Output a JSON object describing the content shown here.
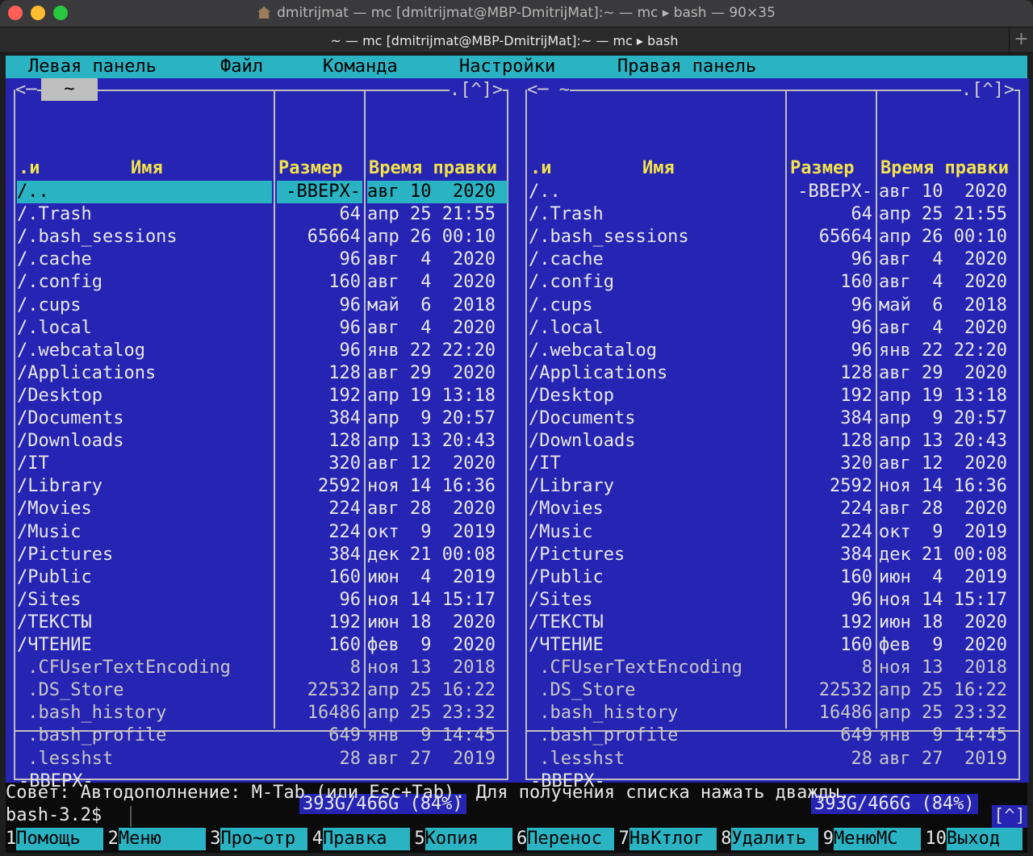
{
  "window": {
    "title": "dmitrijmat — mc [dmitrijmat@MBP-DmitrijMat]:~ — mc ▸ bash — 90×35",
    "tab_title": "~ — mc [dmitrijmat@MBP-DmitrijMat]:~ — mc ▸ bash",
    "plus": "+"
  },
  "menu": [
    "Левая панель",
    "Файл",
    "Команда",
    "Настройки",
    "Правая панель"
  ],
  "panels": {
    "left": {
      "path": "~",
      "corner_left": "<─",
      "corner_right": ".[^]>",
      "col_n": ".и",
      "col_name": "Имя",
      "col_size": "Размер",
      "col_date": "Время правки",
      "footer_name": "-ВВЕРХ-",
      "footer_disk": "393G/466G (84%)"
    },
    "right": {
      "path": "<─ ~",
      "corner_right": ".[^]>",
      "col_n": ".и",
      "col_name": "Имя",
      "col_size": "Размер",
      "col_date": "Время правки",
      "footer_name": "-ВВЕРХ-",
      "footer_disk": "393G/466G (84%)"
    }
  },
  "files": [
    {
      "name": "/..",
      "size": "-ВВЕРХ-",
      "date": "авг 10  2020"
    },
    {
      "name": "/.Trash",
      "size": "64",
      "date": "апр 25 21:55"
    },
    {
      "name": "/.bash_sessions",
      "size": "65664",
      "date": "апр 26 00:10"
    },
    {
      "name": "/.cache",
      "size": "96",
      "date": "авг  4  2020"
    },
    {
      "name": "/.config",
      "size": "160",
      "date": "авг  4  2020"
    },
    {
      "name": "/.cups",
      "size": "96",
      "date": "май  6  2018"
    },
    {
      "name": "/.local",
      "size": "96",
      "date": "авг  4  2020"
    },
    {
      "name": "/.webcatalog",
      "size": "96",
      "date": "янв 22 22:20"
    },
    {
      "name": "/Applications",
      "size": "128",
      "date": "авг 29  2020"
    },
    {
      "name": "/Desktop",
      "size": "192",
      "date": "апр 19 13:18"
    },
    {
      "name": "/Documents",
      "size": "384",
      "date": "апр  9 20:57"
    },
    {
      "name": "/Downloads",
      "size": "128",
      "date": "апр 13 20:43"
    },
    {
      "name": "/IT",
      "size": "320",
      "date": "авг 12  2020"
    },
    {
      "name": "/Library",
      "size": "2592",
      "date": "ноя 14 16:36"
    },
    {
      "name": "/Movies",
      "size": "224",
      "date": "авг 28  2020"
    },
    {
      "name": "/Music",
      "size": "224",
      "date": "окт  9  2019"
    },
    {
      "name": "/Pictures",
      "size": "384",
      "date": "дек 21 00:08"
    },
    {
      "name": "/Public",
      "size": "160",
      "date": "июн  4  2019"
    },
    {
      "name": "/Sites",
      "size": "96",
      "date": "ноя 14 15:17"
    },
    {
      "name": "/ТЕКСТЫ",
      "size": "192",
      "date": "июн 18  2020"
    },
    {
      "name": "/ЧТЕНИЕ",
      "size": "160",
      "date": "фев  9  2020"
    },
    {
      "name": " .CFUserTextEncoding",
      "size": "8",
      "date": "ноя 13  2018"
    },
    {
      "name": " .DS_Store",
      "size": "22532",
      "date": "апр 25 16:22"
    },
    {
      "name": " .bash_history",
      "size": "16486",
      "date": "апр 25 23:32"
    },
    {
      "name": " .bash_profile",
      "size": "649",
      "date": "янв  9 14:45"
    },
    {
      "name": " .lesshst",
      "size": "28",
      "date": "авг 27  2019"
    }
  ],
  "hint": "Совет: Автодополнение: M-Tab (или Esc+Tab). Для получения списка нажать дважды.",
  "prompt": "bash-3.2$",
  "caret_button": "[^]",
  "fkeys": [
    {
      "num": "1",
      "label": "Помощь"
    },
    {
      "num": "2",
      "label": "Меню"
    },
    {
      "num": "3",
      "label": "Про~отр"
    },
    {
      "num": "4",
      "label": "Правка"
    },
    {
      "num": "5",
      "label": "Копия"
    },
    {
      "num": "6",
      "label": "Перенос"
    },
    {
      "num": "7",
      "label": "НвКтлог"
    },
    {
      "num": "8",
      "label": "Удалить"
    },
    {
      "num": "9",
      "label": "МенюМС"
    },
    {
      "num": "10",
      "label": "Выход"
    }
  ]
}
